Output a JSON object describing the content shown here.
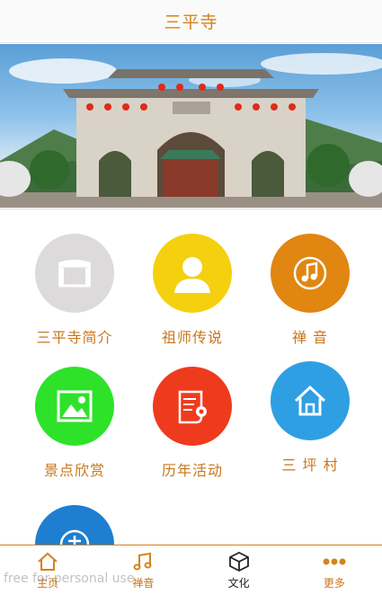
{
  "header": {
    "title": "三平寺"
  },
  "banner": {
    "alt": ""
  },
  "menu": [
    {
      "label": "三平寺简介",
      "color": "#dcdada",
      "icon": "storefront-icon"
    },
    {
      "label": "祖师传说",
      "color": "#f4d00e",
      "icon": "person-icon"
    },
    {
      "label": "禅  音",
      "color": "#e08611",
      "icon": "music-note-icon"
    },
    {
      "label": "景点欣赏",
      "color": "#2ee22a",
      "icon": "picture-icon"
    },
    {
      "label": "历年活动",
      "color": "#ee3b1e",
      "icon": "scroll-icon"
    },
    {
      "label": "三 坪 村",
      "color": "#2f9fe3",
      "icon": "home-icon"
    },
    {
      "label": "",
      "color": "#1e7fd0",
      "icon": "poem-icon"
    }
  ],
  "tabbar": {
    "items": [
      {
        "label": "主页",
        "icon": "home-outline-icon"
      },
      {
        "label": "禅音",
        "icon": "music-notes-icon"
      },
      {
        "label": "文化",
        "icon": "cube-icon"
      },
      {
        "label": "更多",
        "icon": "more-dots-icon"
      }
    ],
    "active_index": 2,
    "accent": "#d4821c"
  },
  "watermark": "free for personal use"
}
